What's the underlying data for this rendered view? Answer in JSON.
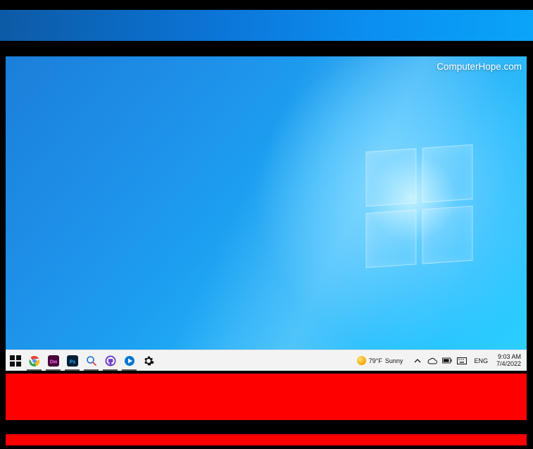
{
  "watermark": "ComputerHope.com",
  "taskbar": {
    "apps": [
      {
        "name": "start-button",
        "icon": "windows"
      },
      {
        "name": "chrome-button",
        "icon": "chrome"
      },
      {
        "name": "dreamweaver-button",
        "icon": "dw"
      },
      {
        "name": "photoshop-button",
        "icon": "ps"
      },
      {
        "name": "search-button",
        "icon": "magnifier"
      },
      {
        "name": "github-button",
        "icon": "github"
      },
      {
        "name": "media-button",
        "icon": "play"
      },
      {
        "name": "settings-button",
        "icon": "gear"
      }
    ],
    "weather": {
      "temp": "79°F",
      "cond": "Sunny"
    },
    "lang": "ENG",
    "clock": {
      "time": "9:03 AM",
      "date": "7/4/2022"
    }
  }
}
